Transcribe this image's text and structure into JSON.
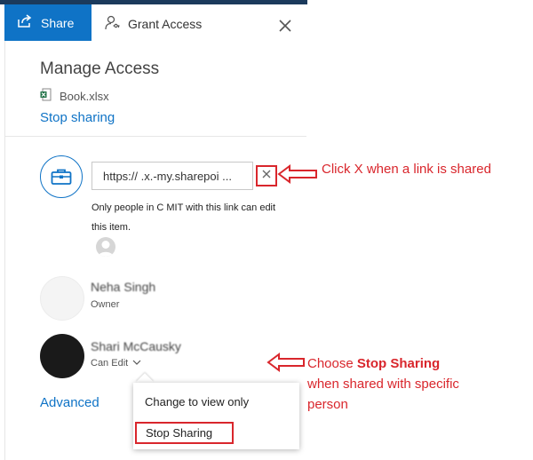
{
  "header": {
    "share_tab": "Share",
    "grant_tab": "Grant Access",
    "close_icon": "close-icon"
  },
  "manage": {
    "title": "Manage Access",
    "file_name": "Book.xlsx",
    "stop_sharing": "Stop sharing"
  },
  "link": {
    "url": "https://  .x.-my.sharepoi ...",
    "permission_text": "Only people in C   MIT with this link can edit this item.",
    "remove_icon": "close-icon"
  },
  "people": [
    {
      "name": "Neha Singh",
      "role": "Owner"
    },
    {
      "name": "Shari McCausky",
      "role": "Can Edit"
    }
  ],
  "advanced": "Advanced",
  "dropdown": {
    "items": [
      "Change to view only",
      "Stop Sharing"
    ]
  },
  "annotations": {
    "link_note": "Click X when a  link is shared",
    "stop_prefix": "Choose ",
    "stop_bold": "Stop Sharing",
    "stop_rest": "when shared with specific person"
  },
  "colors": {
    "accent": "#0f73c6",
    "annotation_red": "#d9262c"
  }
}
